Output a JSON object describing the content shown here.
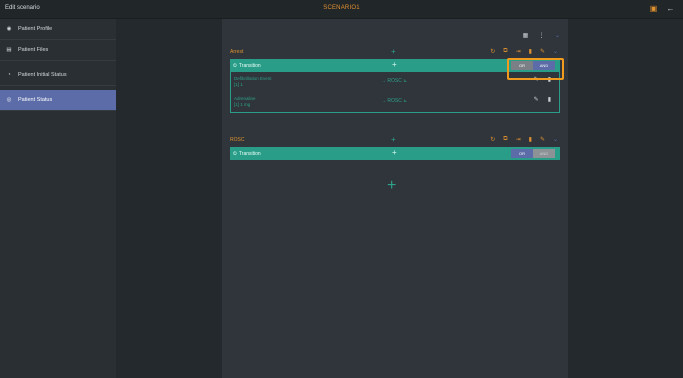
{
  "header": {
    "title": "Edit scenario",
    "scenario_name": "SCENARIO1",
    "icons": [
      "save-icon",
      "back-arrow-icon"
    ]
  },
  "sidebar": {
    "items": [
      {
        "label": "Patient Profile",
        "icon": "profile-icon",
        "active": false
      },
      {
        "label": "Patient Files",
        "icon": "file-icon",
        "active": false
      },
      {
        "label": "Patient Initial Status",
        "icon": "status-icon",
        "active": false
      },
      {
        "label": "Patient Status",
        "icon": "patient-status-icon",
        "active": true
      }
    ]
  },
  "blocks": [
    {
      "title": "Arrest",
      "transition_label": "Transition",
      "or_label": "OR",
      "and_label": "AND",
      "conditions": [
        {
          "name": "Defibrillation Event",
          "value": "[1] 1",
          "target": "ROSC"
        },
        {
          "name": "Adrenaline",
          "value": "[1] 1 mg",
          "target": "ROSC"
        }
      ]
    },
    {
      "title": "ROSC",
      "transition_label": "Transition",
      "or_label": "OR",
      "and_label": "AND",
      "conditions": []
    }
  ],
  "colors": {
    "accent": "#e0912f",
    "teal": "#2a9d88",
    "active_sidebar": "#5b6ca8",
    "highlight": "#f09a1e"
  }
}
